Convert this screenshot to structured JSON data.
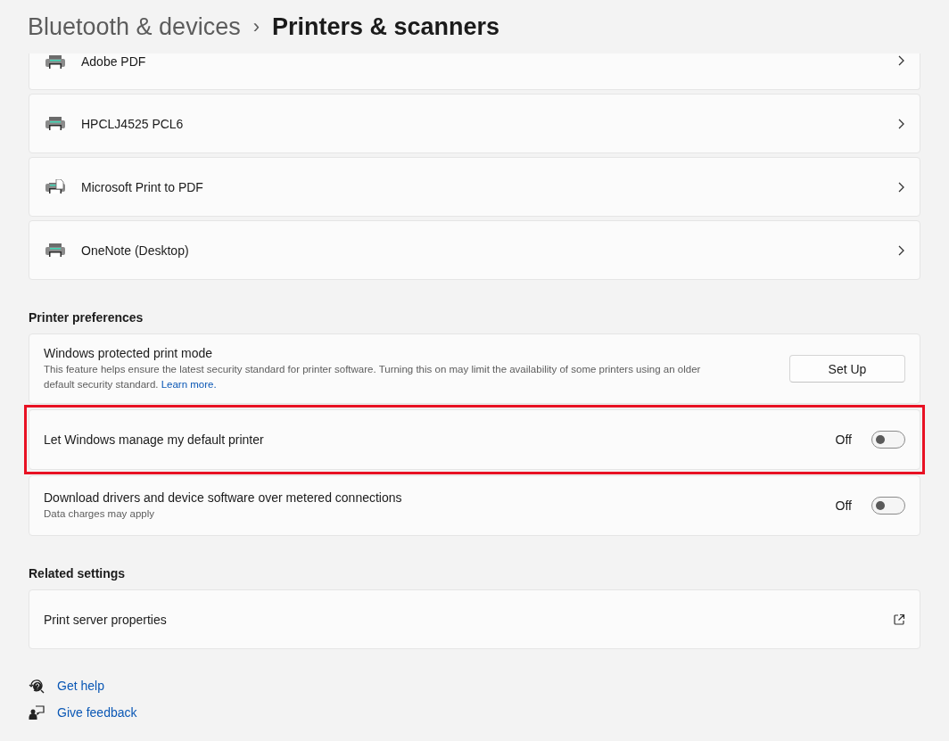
{
  "breadcrumb": {
    "parent": "Bluetooth & devices",
    "separator": "›",
    "current": "Printers & scanners"
  },
  "printers": [
    {
      "name": "Adobe PDF",
      "kind": "printer"
    },
    {
      "name": "HPCLJ4525 PCL6",
      "kind": "printer"
    },
    {
      "name": "Microsoft Print to PDF",
      "kind": "pdf-printer"
    },
    {
      "name": "OneNote (Desktop)",
      "kind": "printer"
    }
  ],
  "printer_preferences": {
    "heading": "Printer preferences",
    "items": [
      {
        "kind": "button",
        "title": "Windows protected print mode",
        "description": "This feature helps ensure the latest security standard for printer software. Turning this on may limit the availability of some printers using an older default security standard.",
        "link": "Learn more.",
        "button": "Set Up",
        "highlighted": false
      },
      {
        "kind": "toggle",
        "title": "Let Windows manage my default printer",
        "state_label": "Off",
        "on": false,
        "highlighted": true
      },
      {
        "kind": "toggle",
        "title": "Download drivers and device software over metered connections",
        "description": "Data charges may apply",
        "state_label": "Off",
        "on": false,
        "highlighted": false
      }
    ]
  },
  "related_settings": {
    "heading": "Related settings",
    "items": [
      {
        "title": "Print server properties",
        "kind": "external"
      }
    ]
  },
  "footer_links": [
    {
      "label": "Get help",
      "kind": "help"
    },
    {
      "label": "Give feedback",
      "kind": "feedback"
    }
  ]
}
